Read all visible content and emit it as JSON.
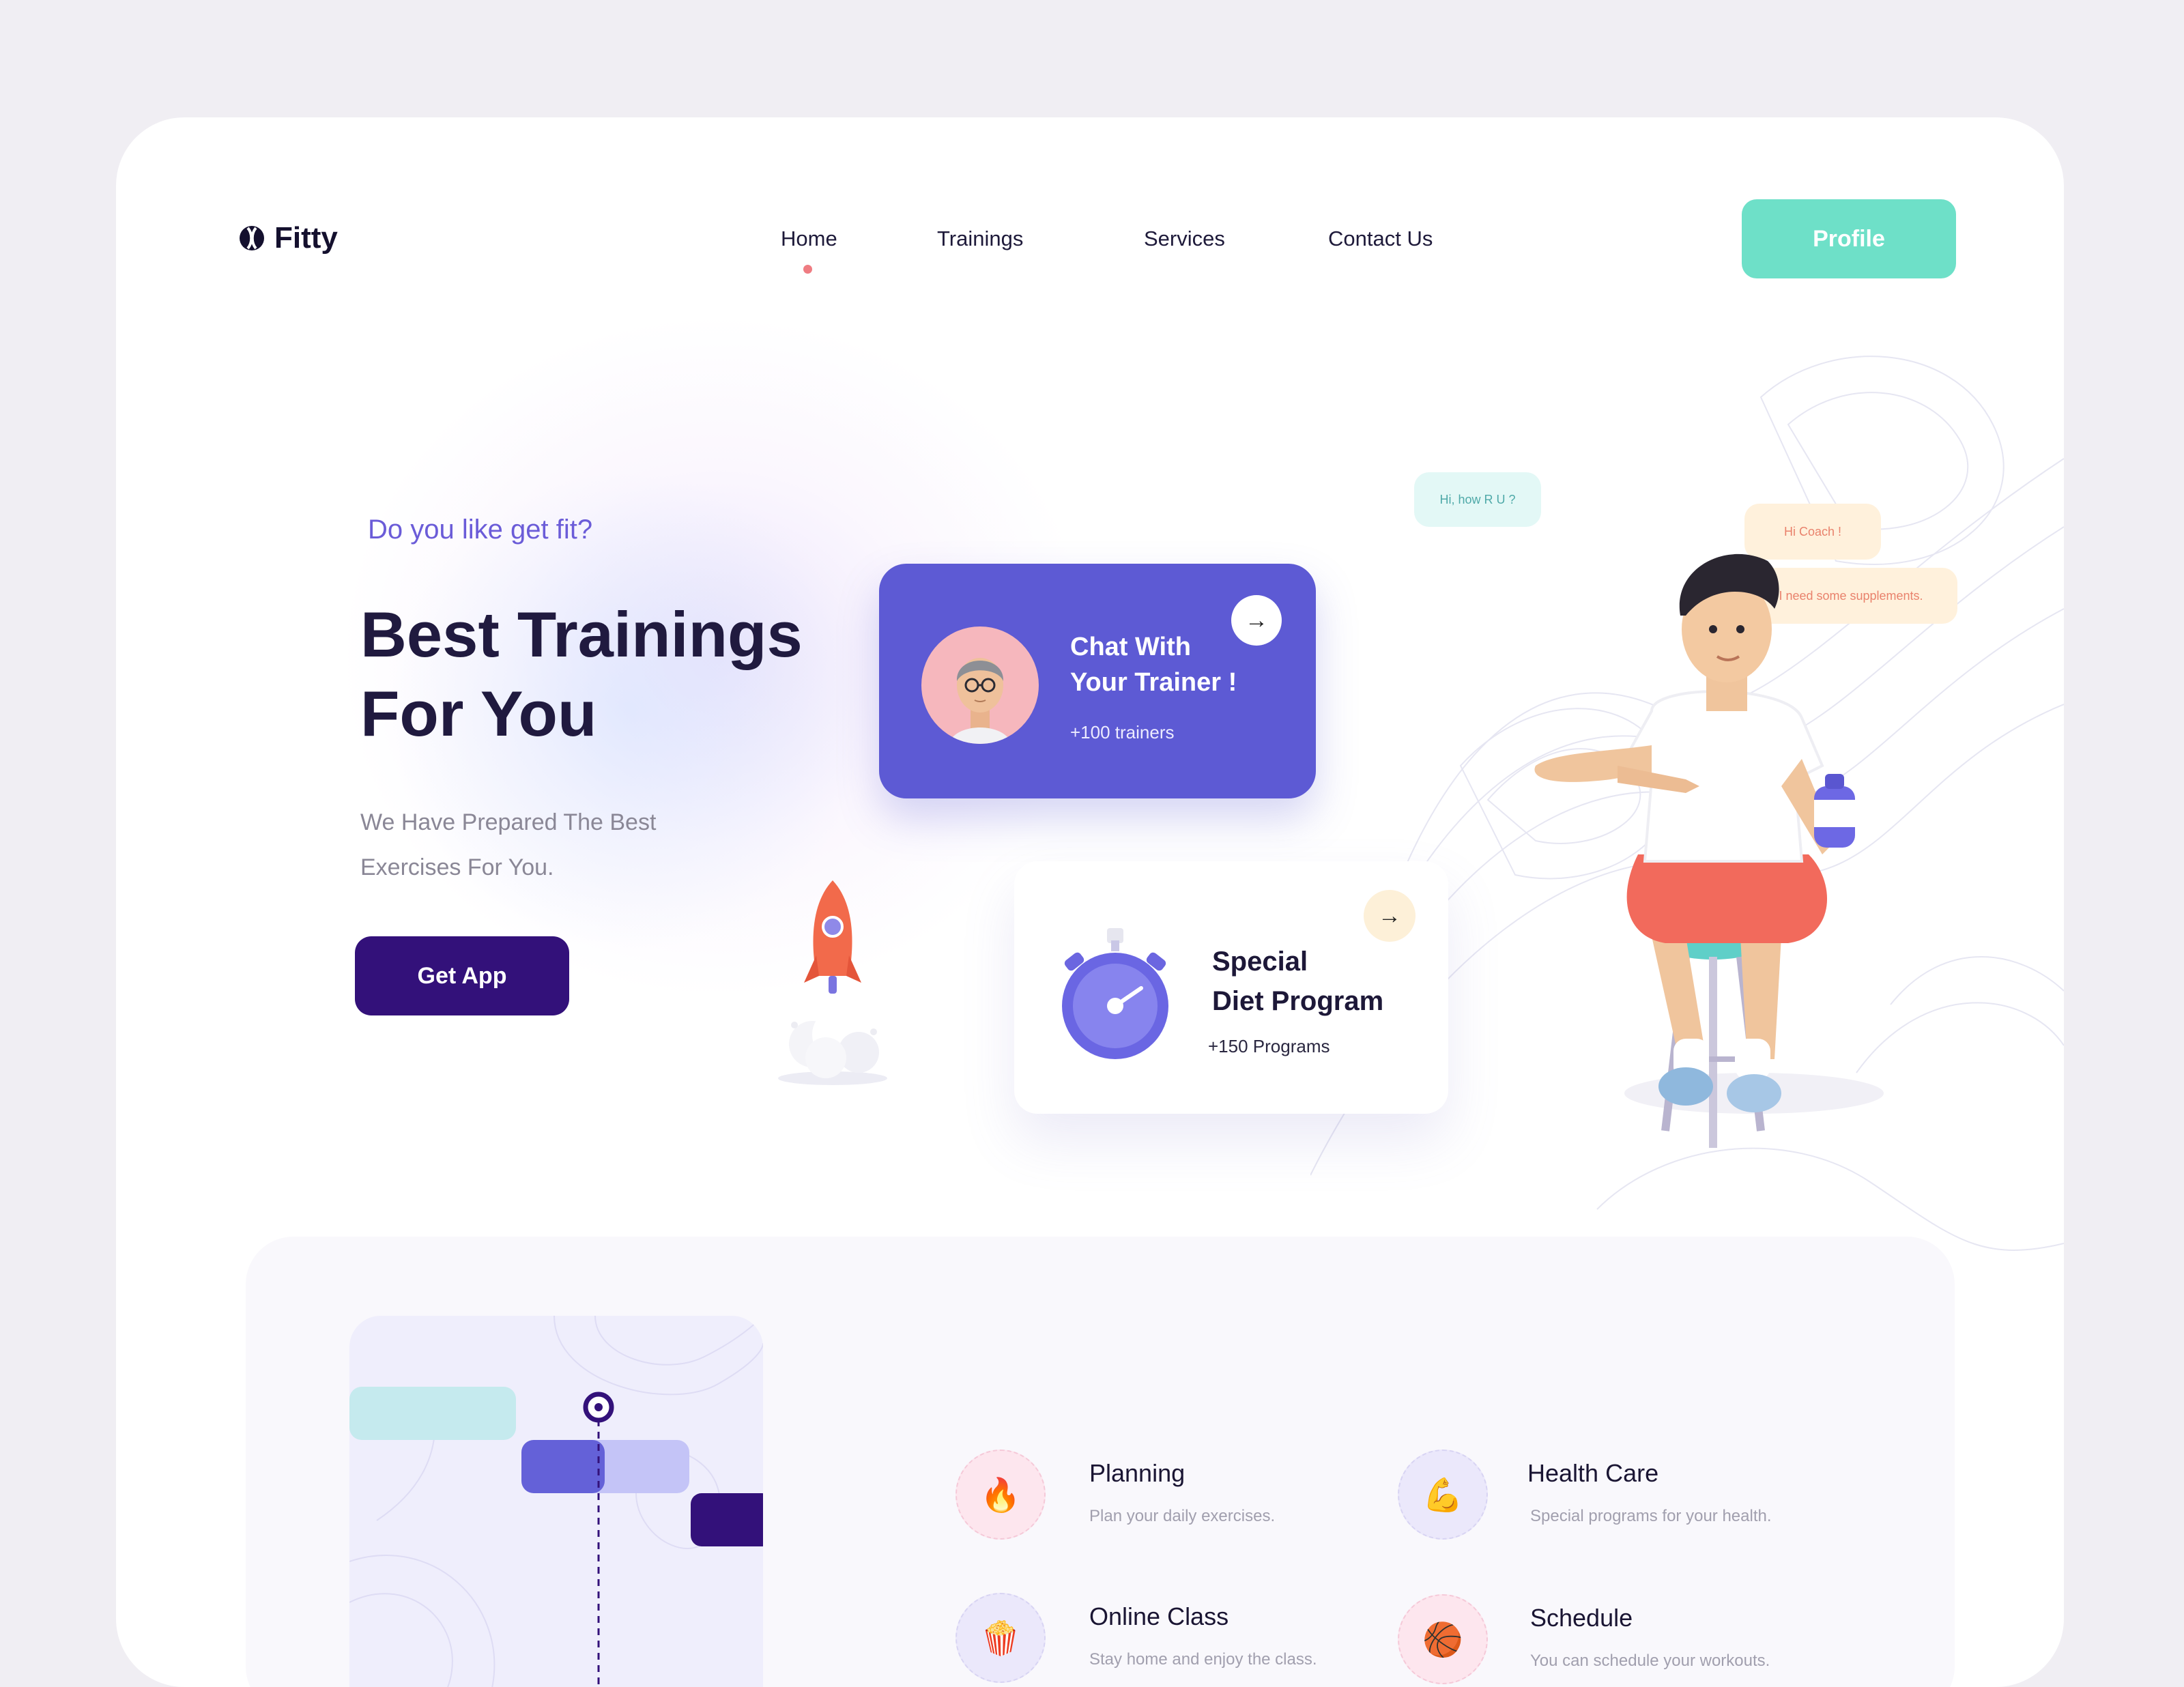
{
  "brand": {
    "name": "Fitty"
  },
  "nav": {
    "items": [
      {
        "label": "Home",
        "active": true
      },
      {
        "label": "Trainings"
      },
      {
        "label": "Services"
      },
      {
        "label": "Contact Us"
      }
    ],
    "profile_label": "Profile"
  },
  "hero": {
    "eyebrow": "Do you like get fit?",
    "headline_line1": "Best Trainings",
    "headline_line2": "For You",
    "subtext_line1": "We Have Prepared The Best",
    "subtext_line2": "Exercises For You.",
    "cta_label": "Get App"
  },
  "trainer_card": {
    "title_line1": "Chat With",
    "title_line2": "Your Trainer !",
    "subtitle": "+100 trainers",
    "arrow_icon": "arrow-right-icon"
  },
  "diet_card": {
    "title_line1": "Special",
    "title_line2": "Diet Program",
    "subtitle": "+150 Programs",
    "arrow_icon": "arrow-right-icon"
  },
  "chat": {
    "bubble1": "Hi, how R U ?",
    "bubble2": "Hi Coach !",
    "bubble3": "I need some supplements."
  },
  "features": [
    {
      "title": "Planning",
      "desc": "Plan your daily exercises.",
      "icon": "fire-icon"
    },
    {
      "title": "Health Care",
      "desc": "Special programs for your health.",
      "icon": "flexed-bicep-icon"
    },
    {
      "title": "Online Class",
      "desc": "Stay home and enjoy the class.",
      "icon": "popcorn-icon"
    },
    {
      "title": "Schedule",
      "desc": "You can schedule your workouts.",
      "icon": "basketball-icon"
    }
  ],
  "colors": {
    "background": "#f0eef3",
    "accent_purple": "#5d5ad4",
    "dark_purple": "#33117a",
    "mint": "#6ee0c8",
    "heading": "#201a3f",
    "eyebrow": "#6b5cd8"
  }
}
